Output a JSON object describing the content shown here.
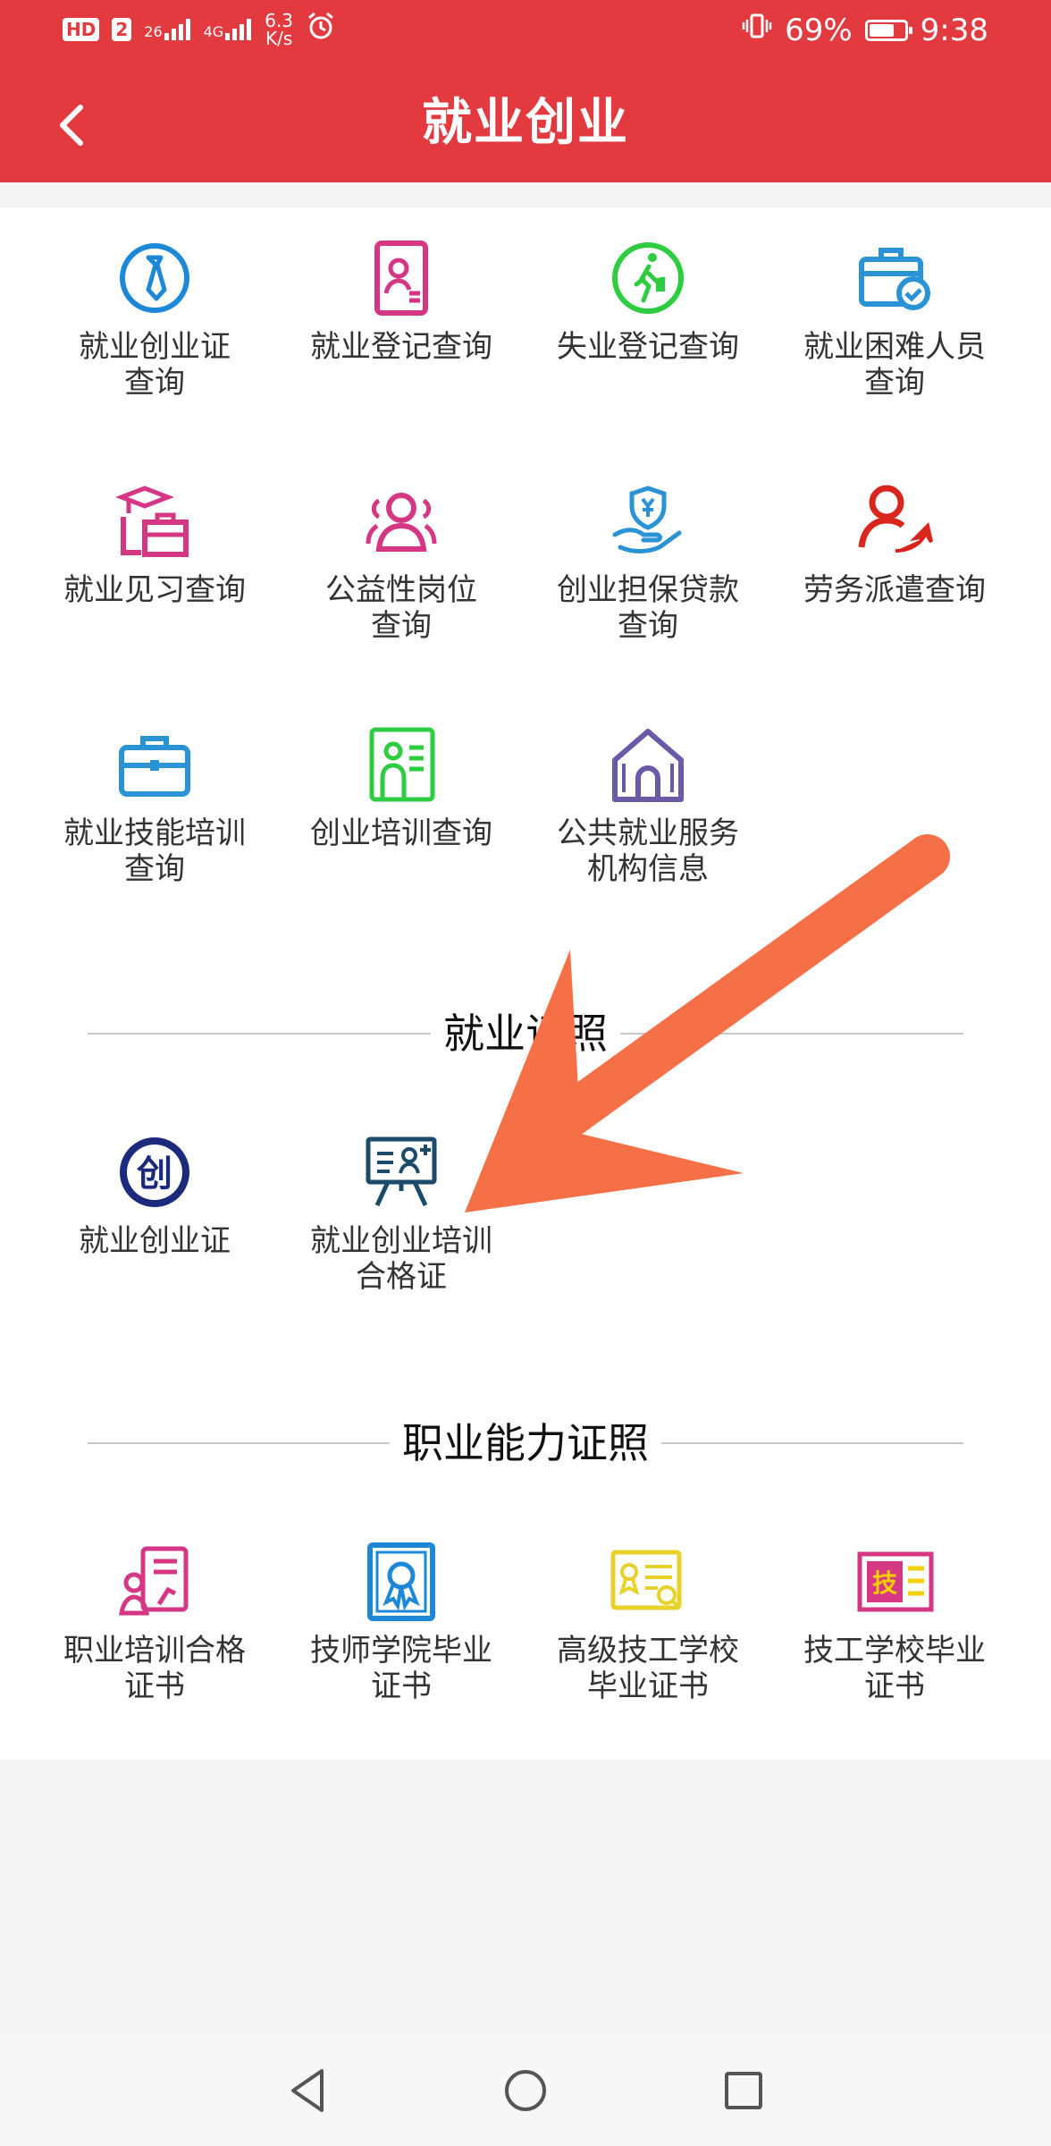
{
  "status_bar": {
    "left_chip_hd": "HD",
    "left_chip_num": "2",
    "signal_1": "26",
    "signal_2": "4G",
    "net_speed_value": "6.3",
    "net_speed_unit": "K/s",
    "battery_percent": "69%",
    "time": "9:38",
    "battery_level": 0.69
  },
  "header": {
    "title": "就业创业",
    "back_icon": "chevron-left-icon"
  },
  "query_items": [
    {
      "name": "employment-certificate-query",
      "label_line1": "就业创业证",
      "label_line2": "查询",
      "icon": "tie-badge-icon",
      "color": "#1e88d8"
    },
    {
      "name": "employment-registration-query",
      "label_line1": "就业登记查询",
      "label_line2": "",
      "icon": "id-card-icon",
      "color": "#d63784"
    },
    {
      "name": "unemployment-registration-query",
      "label_line1": "失业登记查询",
      "label_line2": "",
      "icon": "walking-person-icon",
      "color": "#2ecc40"
    },
    {
      "name": "difficult-employment-query",
      "label_line1": "就业困难人员",
      "label_line2": "查询",
      "icon": "briefcase-check-icon",
      "color": "#2a93d6"
    },
    {
      "name": "internship-query",
      "label_line1": "就业见习查询",
      "label_line2": "",
      "icon": "graduate-briefcase-icon",
      "color": "#d63784"
    },
    {
      "name": "public-welfare-job-query",
      "label_line1": "公益性岗位",
      "label_line2": "查询",
      "icon": "group-people-icon",
      "color": "#d63784"
    },
    {
      "name": "startup-loan-query",
      "label_line1": "创业担保贷款",
      "label_line2": "查询",
      "icon": "hand-shield-yuan-icon",
      "color": "#2a93d6"
    },
    {
      "name": "labor-dispatch-query",
      "label_line1": "劳务派遣查询",
      "label_line2": "",
      "icon": "person-arrow-icon",
      "color": "#d9261c"
    },
    {
      "name": "skill-training-query",
      "label_line1": "就业技能培训",
      "label_line2": "查询",
      "icon": "toolbox-icon",
      "color": "#2a93d6"
    },
    {
      "name": "startup-training-query",
      "label_line1": "创业培训查询",
      "label_line2": "",
      "icon": "training-card-icon",
      "color": "#2ecc40"
    },
    {
      "name": "public-service-agency-info",
      "label_line1": "公共就业服务",
      "label_line2": "机构信息",
      "icon": "house-icon",
      "color": "#6a5aa8"
    }
  ],
  "section_employment_cert": {
    "title": "就业证照"
  },
  "employment_cert_items": [
    {
      "name": "employment-certificate",
      "label_line1": "就业创业证",
      "label_line2": "",
      "icon": "chuang-badge-icon",
      "color": "#1b2a7a"
    },
    {
      "name": "startup-training-certificate",
      "label_line1": "就业创业培训",
      "label_line2": "合格证",
      "icon": "presentation-board-icon",
      "color": "#1b4a6a"
    }
  ],
  "section_vocational_cert": {
    "title": "职业能力证照"
  },
  "vocational_cert_items": [
    {
      "name": "vocational-training-certificate",
      "label_line1": "职业培训合格",
      "label_line2": "证书",
      "icon": "certificate-person-icon",
      "color": "#d63784"
    },
    {
      "name": "technician-college-diploma",
      "label_line1": "技师学院毕业",
      "label_line2": "证书",
      "icon": "award-ribbon-icon",
      "color": "#1e88d8"
    },
    {
      "name": "advanced-technical-school-diploma",
      "label_line1": "高级技工学校",
      "label_line2": "毕业证书",
      "icon": "certificate-search-icon",
      "color": "#e8d22a"
    },
    {
      "name": "technical-school-diploma",
      "label_line1": "技工学校毕业",
      "label_line2": "证书",
      "icon": "ji-card-icon",
      "color": "#d63784",
      "badge_text": "技"
    }
  ],
  "nav_bar": {
    "back": "triangle-back-icon",
    "home": "circle-home-icon",
    "recent": "square-recent-icon"
  }
}
